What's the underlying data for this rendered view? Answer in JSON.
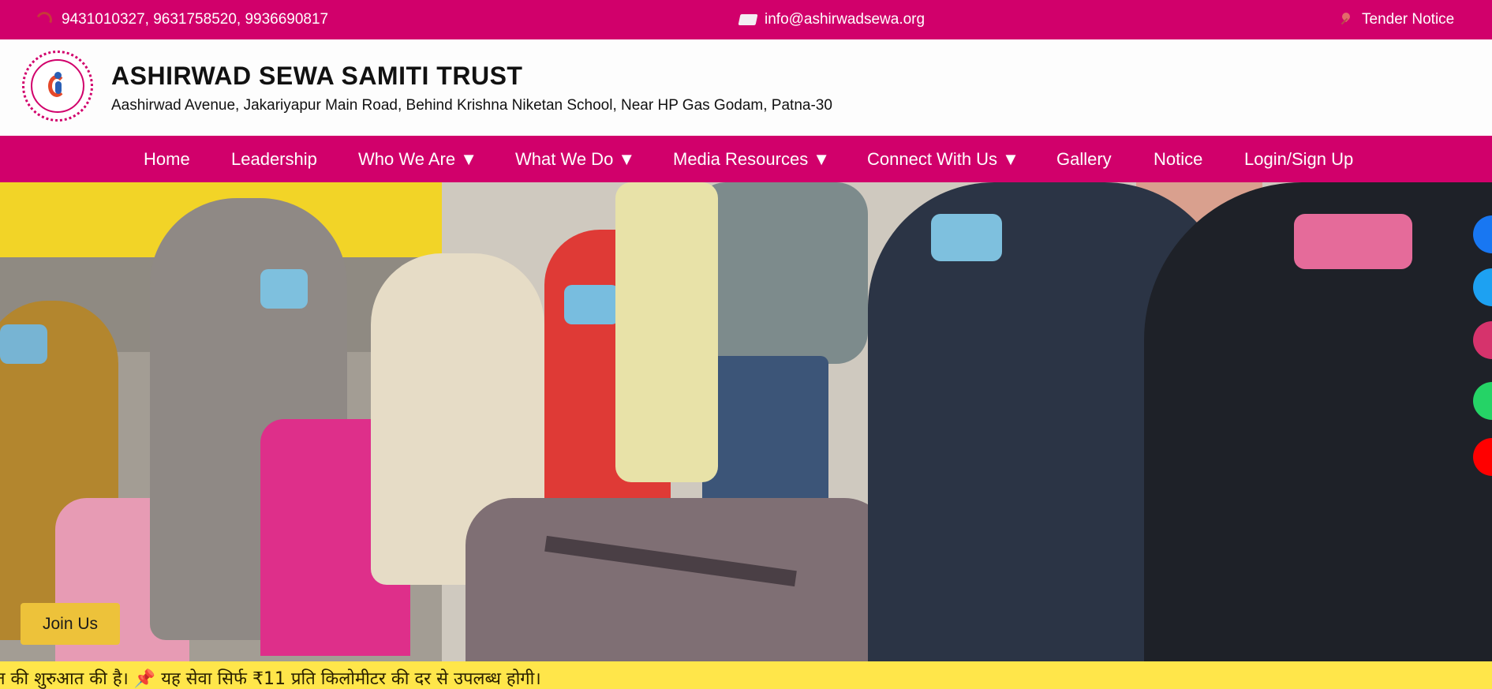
{
  "topbar": {
    "phones": "9431010327, 9631758520, 9936690817",
    "email": "info@ashirwadsewa.org",
    "tender": "Tender Notice",
    "icons": [
      "phone-icon",
      "mail-icon",
      "pin-icon"
    ]
  },
  "header": {
    "title": "ASHIRWAD SEWA SAMITI TRUST",
    "address": "Aashirwad Avenue, Jakariyapur Main Road, Behind Krishna Niketan School, Near HP Gas Godam, Patna-30"
  },
  "nav": {
    "items": [
      {
        "label": "Home"
      },
      {
        "label": "Leadership"
      },
      {
        "label": "Who We Are ▼"
      },
      {
        "label": "What We Do ▼"
      },
      {
        "label": "Media Resources ▼"
      },
      {
        "label": "Connect With Us ▼"
      },
      {
        "label": "Gallery"
      },
      {
        "label": "Notice"
      },
      {
        "label": "Login/Sign Up"
      }
    ]
  },
  "hero": {
    "join_label": "Join Us",
    "social": [
      "facebook-icon",
      "twitter-icon",
      "instagram-icon",
      "whatsapp-icon",
      "youtube-icon"
    ]
  },
  "ticker": {
    "text": "त की शुरुआत की है। 📌 यह सेवा सिर्फ ₹11 प्रति किलोमीटर की दर से उपलब्ध होगी।"
  },
  "colors": {
    "brand": "#d1006b",
    "join": "#edc23a",
    "ticker": "#ffe64a"
  }
}
